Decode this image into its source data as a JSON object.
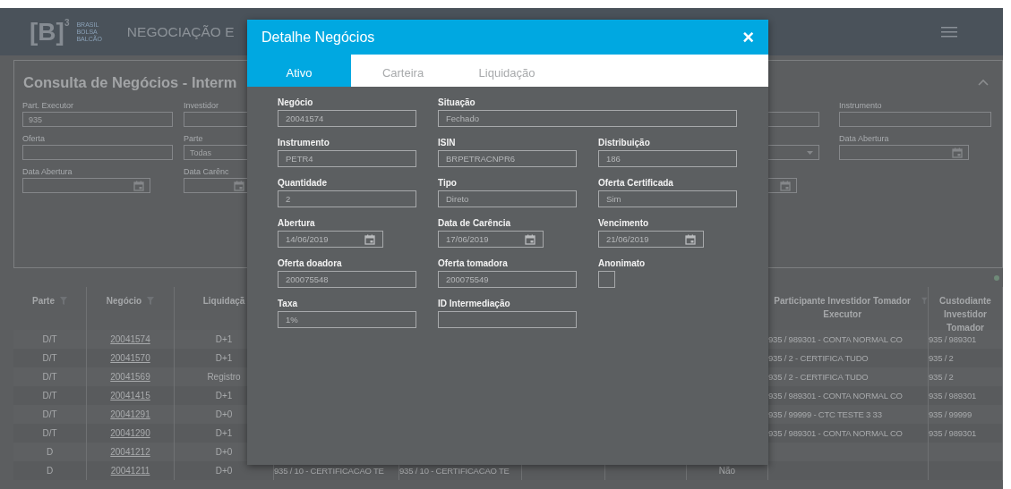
{
  "header": {
    "logo": {
      "mark": "[B]",
      "superscript": "3",
      "tagline": [
        "BRASIL",
        "BOLSA",
        "BALCÃO"
      ]
    },
    "title": "NEGOCIAÇÃO E"
  },
  "filter_panel": {
    "title": "Consulta de Negócios - Interm",
    "expanded": true,
    "left_columns": [
      [
        {
          "label": "Part. Executor",
          "value": "935",
          "kind": "text"
        },
        {
          "label": "Oferta",
          "kind": "text"
        },
        {
          "label": "Data Abertura",
          "kind": "date"
        }
      ],
      [
        {
          "label": "Investidor",
          "kind": "text"
        },
        {
          "label": "Parte",
          "value": "Todas",
          "kind": "text"
        },
        {
          "label": "Data Carênc",
          "kind": "date"
        }
      ]
    ],
    "right_columns": [
      [
        {
          "kind": "text"
        },
        {
          "kind": "select"
        },
        {
          "kind": "date"
        }
      ],
      [
        {
          "label": "Instrumento",
          "kind": "text"
        },
        {
          "label": "Data Abertura",
          "kind": "date"
        }
      ]
    ]
  },
  "table": {
    "columns": [
      {
        "label": "Parte",
        "filter": true
      },
      {
        "label": "Negócio",
        "filter": true,
        "kind": "link"
      },
      {
        "label": "Liquidaçã",
        "filter": false
      },
      {},
      {},
      {},
      {},
      {},
      {
        "label": "Participante Investidor Tomador Executor",
        "filter": true
      },
      {
        "label": "Custodiante Investidor Tomador",
        "filter": false
      }
    ],
    "rows": [
      [
        "D/T",
        "20041574",
        "D+1",
        null,
        null,
        null,
        null,
        null,
        "935 / 989301 - CONTA NORMAL CO",
        "935 / 989301"
      ],
      [
        "D/T",
        "20041570",
        "D+1",
        null,
        null,
        null,
        null,
        null,
        "935 / 2 - CERTIFICA TUDO",
        "935 / 2"
      ],
      [
        "D/T",
        "20041569",
        "Registro",
        null,
        null,
        null,
        null,
        null,
        "935 / 2 - CERTIFICA TUDO",
        "935 / 2"
      ],
      [
        "D/T",
        "20041415",
        "D+1",
        null,
        null,
        null,
        null,
        null,
        "935 / 989301 - CONTA NORMAL CO",
        "935 / 989301"
      ],
      [
        "D/T",
        "20041291",
        "D+0",
        null,
        null,
        null,
        null,
        null,
        "935 / 99999 - CTC TESTE 3 33",
        "935 / 99999"
      ],
      [
        "D/T",
        "20041290",
        "D+1",
        null,
        null,
        null,
        null,
        null,
        "935 / 989301 - CONTA NORMAL CO",
        "935 / 989301"
      ],
      [
        "D",
        "20041212",
        "D+0",
        null,
        null,
        null,
        null,
        null,
        null,
        null
      ],
      [
        "D",
        "20041211",
        "D+0",
        "935 / 10 - CERTIFICACAO TE",
        "935 / 10 - CERTIFICACAO TE",
        null,
        null,
        "Não",
        null,
        null
      ]
    ]
  },
  "modal": {
    "title": "Detalhe Negócios",
    "close": "×",
    "tabs": [
      {
        "label": "Ativo",
        "selected": true
      },
      {
        "label": "Carteira",
        "selected": false
      },
      {
        "label": "Liquidação",
        "selected": false
      }
    ],
    "fields": [
      {
        "label": "Negócio",
        "value": "20041574",
        "kind": "text"
      },
      {
        "label": "Situação",
        "value": "Fechado",
        "kind": "wide"
      },
      {
        "label": "Instrumento",
        "value": "PETR4",
        "kind": "text"
      },
      {
        "label": "ISIN",
        "value": "BRPETRACNPR6",
        "kind": "text"
      },
      {
        "label": "Distribuição",
        "value": "186",
        "kind": "text"
      },
      {
        "label": "Quantidade",
        "value": "2",
        "kind": "text"
      },
      {
        "label": "Tipo",
        "value": "Direto",
        "kind": "text"
      },
      {
        "label": "Oferta Certificada",
        "value": "Sim",
        "kind": "text"
      },
      {
        "label": "Abertura",
        "value": "14/06/2019",
        "kind": "date"
      },
      {
        "label": "Data de Carência",
        "value": "17/06/2019",
        "kind": "date"
      },
      {
        "label": "Vencimento",
        "value": "21/06/2019",
        "kind": "date"
      },
      {
        "label": "Oferta doadora",
        "value": "200075548",
        "kind": "text"
      },
      {
        "label": "Oferta tomadora",
        "value": "200075549",
        "kind": "text"
      },
      {
        "label": "Anonimato",
        "kind": "checkbox",
        "checked": false
      },
      {
        "label": "Taxa",
        "value": "1%",
        "kind": "text"
      },
      {
        "label": "ID Intermediação",
        "kind": "text"
      }
    ]
  }
}
